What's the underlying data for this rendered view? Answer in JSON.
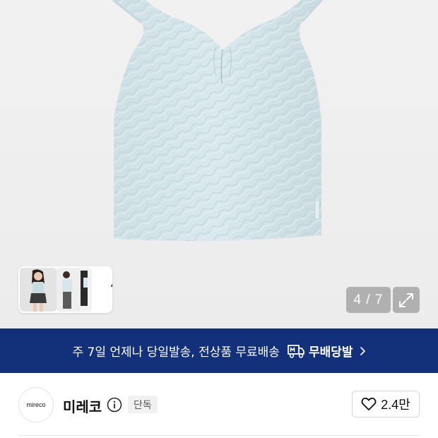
{
  "gallery": {
    "product_image": "light-blue-textured-camisole",
    "ai_card": {
      "label": "AI"
    },
    "counter": {
      "current": "4",
      "total": "7",
      "text": "4 / 7"
    },
    "expand_icon": "expand-icon"
  },
  "banner": {
    "text": "주 7일 언제나 당일발송, 전상품 무료배송",
    "brand": "무배당발",
    "logo_icon": "delivery-truck-icon",
    "background": "#13317a"
  },
  "brand": {
    "logo_text": "mireco",
    "name": "미레코",
    "badge": "단독",
    "likes": "2.4만"
  }
}
